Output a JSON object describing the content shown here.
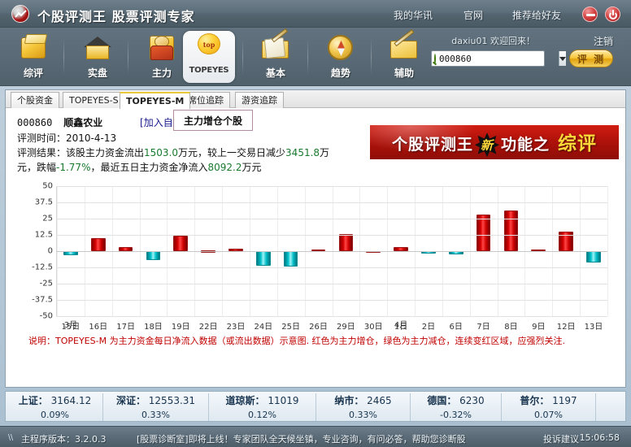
{
  "titlebar": {
    "app_title": "个股评测王  股票评测专家",
    "logo_icon": "chart-line-logo-icon",
    "links": [
      {
        "label": "我的华讯",
        "name": "my-huaxun"
      },
      {
        "label": "官网",
        "name": "official-site"
      },
      {
        "label": "推荐给好友",
        "name": "recommend-friend"
      }
    ],
    "minimize_icon": "minimize-icon",
    "close_icon": "power-close-icon"
  },
  "toolbar": {
    "items": [
      {
        "label": "综评",
        "name": "overview",
        "icon": "gold-box-icon",
        "selected": false
      },
      {
        "label": "实盘",
        "name": "live-market",
        "icon": "house-icon",
        "selected": false
      },
      {
        "label": "主力",
        "name": "main-force",
        "icon": "person-icon",
        "selected": false
      },
      {
        "label": "TOPEYES",
        "name": "topeyes",
        "icon": "topeyes-ball-icon",
        "selected": true
      },
      {
        "label": "基本",
        "name": "fundamentals",
        "icon": "envelope-pen-icon",
        "selected": false
      },
      {
        "label": "趋势",
        "name": "trend",
        "icon": "compass-icon",
        "selected": false
      },
      {
        "label": "辅助",
        "name": "assist",
        "icon": "folder-pen-icon",
        "selected": false
      }
    ],
    "topeyes_ball_text": "top",
    "topeyes_word": "TOPEYES",
    "welcome": "daxiu01  欢迎回来！",
    "logout": "注销",
    "search_value": "000860",
    "search_placeholder": "000860",
    "search_icon": "search-icon",
    "dropdown_icon": "chevron-down-icon",
    "evaluate_button": "评 测"
  },
  "tabs": [
    {
      "label": "个股资金",
      "name": "tab-stock-funds",
      "active": false
    },
    {
      "label": "TOPEYES-S",
      "name": "tab-topeyes-s",
      "active": false
    },
    {
      "label": "TOPEYES-M",
      "name": "tab-topeyes-m",
      "active": true
    },
    {
      "label": "席位追踪",
      "name": "tab-seat-tracking",
      "active": false
    },
    {
      "label": "游资追踪",
      "name": "tab-hotmoney-tracking",
      "active": false
    }
  ],
  "stock": {
    "code": "000860",
    "name": "顺鑫农业",
    "add_favorite": "[加入自选股]",
    "tag": "主力增仓个股",
    "eval_time_label": "评测时间：",
    "eval_time_value": "2010-4-13",
    "eval_result_label": "评测结果：",
    "result_part1": "该股主力资金流出",
    "result_out_value": "1503.0",
    "result_part2": "万元，较上一交易日减少",
    "result_delta_value": "3451.8",
    "result_part3": "万元，跌幅",
    "result_pct": "-1.77%",
    "result_part4": "，最近五日主力资金净流入",
    "result_net5_value": "8092.2",
    "result_part5": "万元"
  },
  "banner": {
    "text_before": "个股评测王",
    "star_text": "新",
    "text_mid": "功能之",
    "text_end": "综评"
  },
  "chart_data": {
    "type": "bar",
    "title": "",
    "xlabel": "",
    "ylabel": "",
    "ylim": [
      -50,
      50
    ],
    "yticks": [
      50,
      37.5,
      25,
      12.5,
      0,
      -12.5,
      -25,
      -37.5,
      -50
    ],
    "grid": true,
    "legend": "none",
    "month_markers": [
      {
        "index": 0,
        "label": "3月"
      },
      {
        "index": 12,
        "label": "4月"
      }
    ],
    "categories": [
      "15日",
      "16日",
      "17日",
      "18日",
      "19日",
      "22日",
      "23日",
      "24日",
      "25日",
      "26日",
      "29日",
      "30日",
      "1日",
      "2日",
      "6日",
      "7日",
      "8日",
      "9日",
      "12日",
      "13日"
    ],
    "values": [
      -3.0,
      10.0,
      3.0,
      -7.0,
      12.0,
      0.5,
      2.0,
      -11.0,
      -12.0,
      1.5,
      13.0,
      0.3,
      3.0,
      -2.0,
      -2.5,
      28.0,
      31.0,
      1.5,
      15.0,
      -9.0
    ],
    "colors": {
      "positive": "#cc0000",
      "negative": "#00bcc6"
    }
  },
  "note": "说明：TOPEYES-M 为主力资金每日净流入数据（或流出数据）示意图. 红色为主力增仓，绿色为主力减仓，连续变红区域，应强烈关注.",
  "indices": [
    {
      "name": "上证",
      "value": "3164.12",
      "pct": "0.09%"
    },
    {
      "name": "深证",
      "value": "12553.31",
      "pct": "0.33%"
    },
    {
      "name": "道琼斯",
      "value": "11019",
      "pct": "0.12%"
    },
    {
      "name": "纳市",
      "value": "2465",
      "pct": "0.33%"
    },
    {
      "name": "德国",
      "value": "6230",
      "pct": "-0.32%"
    },
    {
      "name": "普尔",
      "value": "1197",
      "pct": "0.07%"
    }
  ],
  "statusbar": {
    "version": "主程序版本：3.2.0.3",
    "marquee": "[股票诊断室]即将上线！专家团队全天候坐镇，专业咨询，有问必答，帮助您诊断股",
    "feedback": "投诉建议",
    "time": "15:06:58"
  }
}
